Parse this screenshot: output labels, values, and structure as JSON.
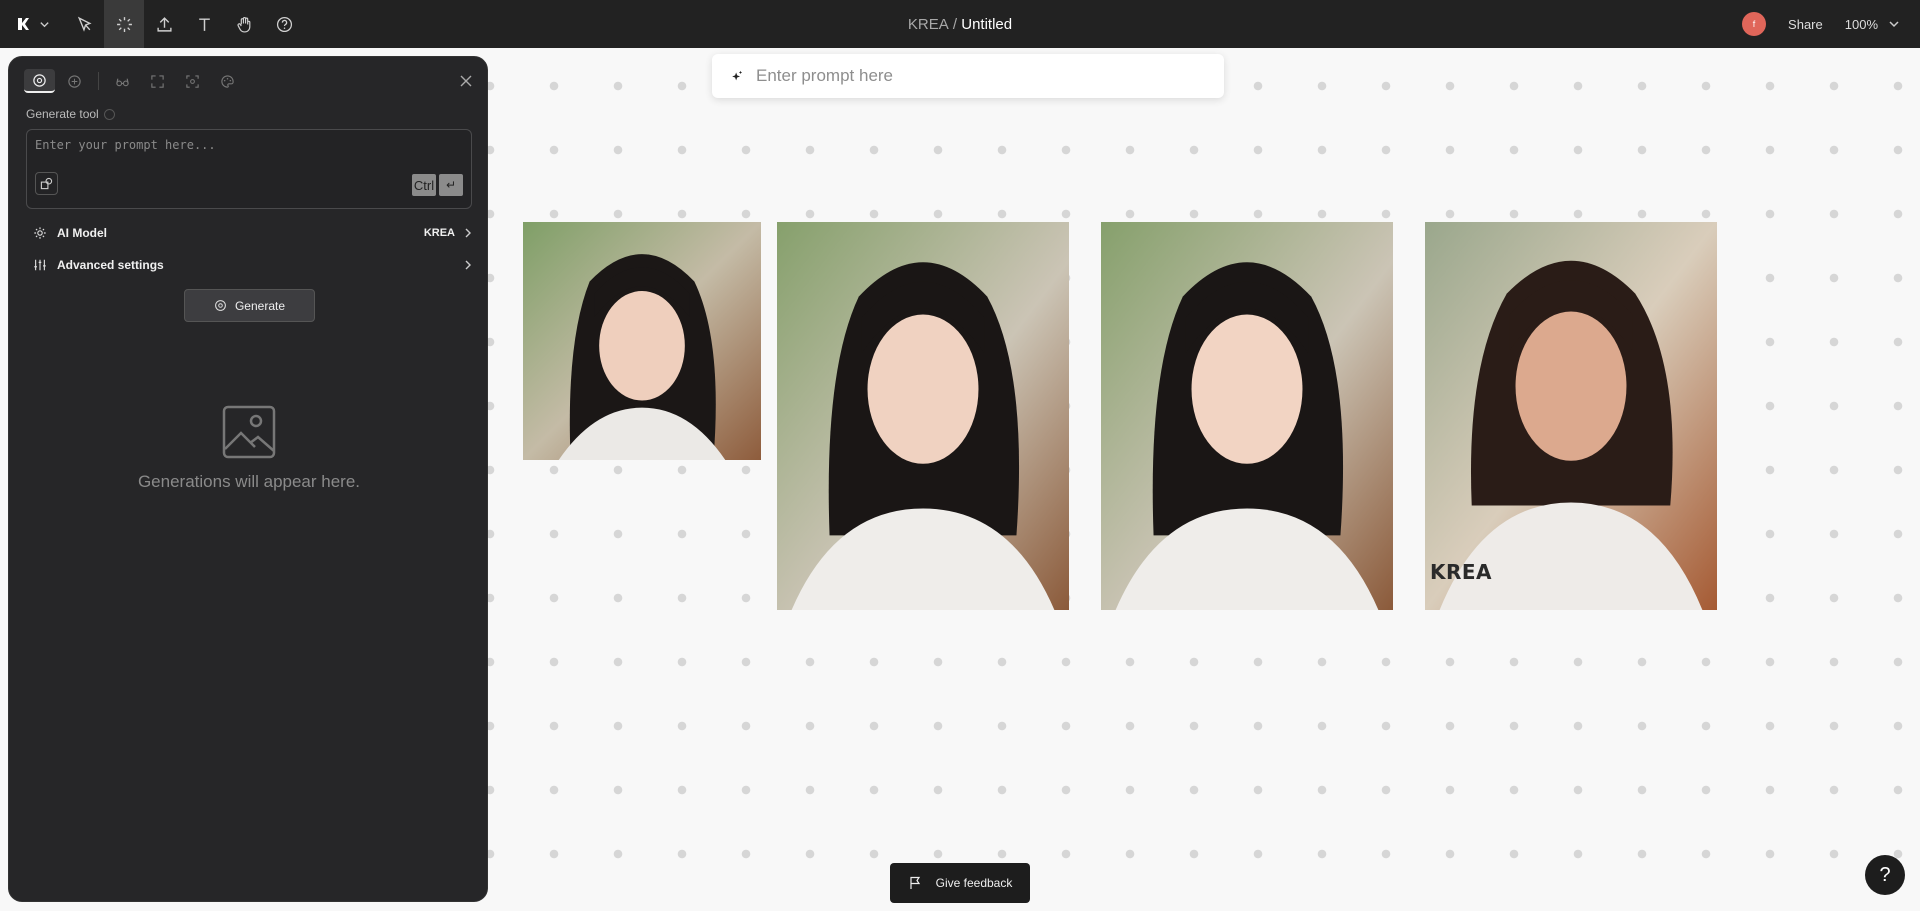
{
  "topbar": {
    "app_name": "KREA",
    "separator": " / ",
    "document_title": "Untitled",
    "avatar_initial": "f",
    "share_label": "Share",
    "zoom_level": "100%",
    "tools": [
      "logo-icon",
      "select-icon",
      "generate-icon",
      "upload-icon",
      "text-icon",
      "hand-icon",
      "help-icon"
    ]
  },
  "panel": {
    "tool_label": "Generate tool",
    "prompt_placeholder": "Enter your prompt here...",
    "kbd_ctrl": "Ctrl",
    "kbd_enter": "↵",
    "ai_model_label": "AI Model",
    "ai_model_value": "KREA",
    "advanced_label": "Advanced settings",
    "generate_label": "Generate",
    "empty_text": "Generations will appear here."
  },
  "canvas": {
    "prompt_placeholder": "Enter prompt here",
    "watermark": "KREA",
    "feedback_label": "Give feedback",
    "help_label": "?"
  },
  "colors": {
    "topbar_bg": "#222222",
    "panel_bg": "#262628",
    "canvas_bg": "#f8f8f8",
    "avatar": "#e0665a"
  }
}
